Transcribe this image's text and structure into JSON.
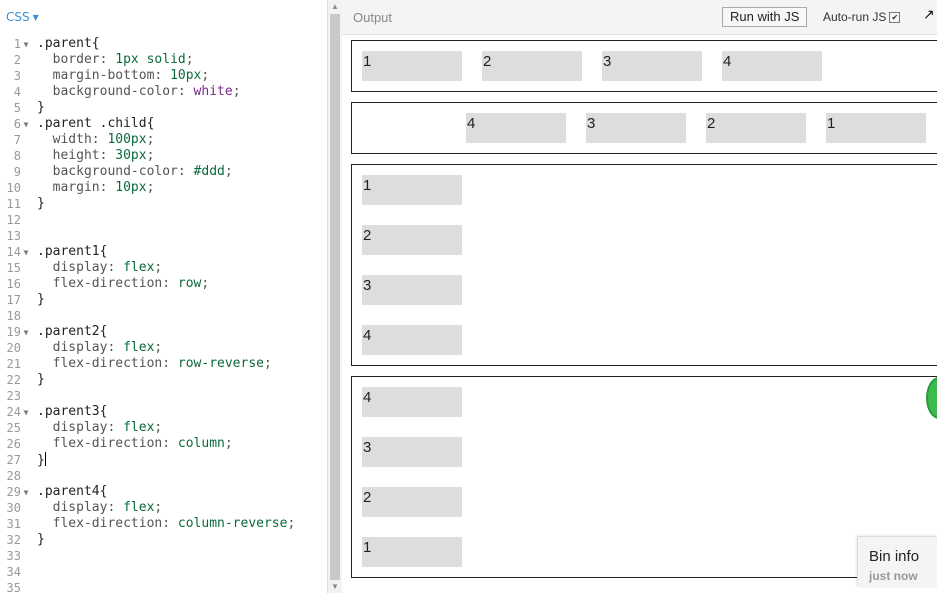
{
  "editor": {
    "language": "CSS",
    "lines": [
      {
        "n": "1",
        "fold": true,
        "parts": [
          [
            ".parent{",
            "sel"
          ]
        ]
      },
      {
        "n": "2",
        "fold": false,
        "parts": [
          [
            "  border: ",
            "kw"
          ],
          [
            "1px solid",
            "val"
          ],
          [
            ";",
            "kw"
          ]
        ]
      },
      {
        "n": "3",
        "fold": false,
        "parts": [
          [
            "  margin-bottom: ",
            "kw"
          ],
          [
            "10px",
            "val"
          ],
          [
            ";",
            "kw"
          ]
        ]
      },
      {
        "n": "4",
        "fold": false,
        "parts": [
          [
            "  background-color: ",
            "kw"
          ],
          [
            "white",
            "valpurple"
          ],
          [
            ";",
            "kw"
          ]
        ]
      },
      {
        "n": "5",
        "fold": false,
        "parts": [
          [
            "}",
            "sel"
          ]
        ]
      },
      {
        "n": "6",
        "fold": true,
        "parts": [
          [
            ".parent .child{",
            "sel"
          ]
        ]
      },
      {
        "n": "7",
        "fold": false,
        "parts": [
          [
            "  width: ",
            "kw"
          ],
          [
            "100px",
            "val"
          ],
          [
            ";",
            "kw"
          ]
        ]
      },
      {
        "n": "8",
        "fold": false,
        "parts": [
          [
            "  height: ",
            "kw"
          ],
          [
            "30px",
            "val"
          ],
          [
            ";",
            "kw"
          ]
        ]
      },
      {
        "n": "9",
        "fold": false,
        "parts": [
          [
            "  background-color: ",
            "kw"
          ],
          [
            "#ddd",
            "val"
          ],
          [
            ";",
            "kw"
          ]
        ]
      },
      {
        "n": "10",
        "fold": false,
        "parts": [
          [
            "  margin: ",
            "kw"
          ],
          [
            "10px",
            "val"
          ],
          [
            ";",
            "kw"
          ]
        ]
      },
      {
        "n": "11",
        "fold": false,
        "parts": [
          [
            "}",
            "sel"
          ]
        ]
      },
      {
        "n": "12",
        "fold": false,
        "parts": []
      },
      {
        "n": "13",
        "fold": false,
        "parts": []
      },
      {
        "n": "14",
        "fold": true,
        "parts": [
          [
            ".parent1{",
            "sel"
          ]
        ]
      },
      {
        "n": "15",
        "fold": false,
        "parts": [
          [
            "  display: ",
            "kw"
          ],
          [
            "flex",
            "val"
          ],
          [
            ";",
            "kw"
          ]
        ]
      },
      {
        "n": "16",
        "fold": false,
        "parts": [
          [
            "  flex-direction: ",
            "kw"
          ],
          [
            "row",
            "val"
          ],
          [
            ";",
            "kw"
          ]
        ]
      },
      {
        "n": "17",
        "fold": false,
        "parts": [
          [
            "}",
            "sel"
          ]
        ]
      },
      {
        "n": "18",
        "fold": false,
        "parts": []
      },
      {
        "n": "19",
        "fold": true,
        "parts": [
          [
            ".parent2{",
            "sel"
          ]
        ]
      },
      {
        "n": "20",
        "fold": false,
        "parts": [
          [
            "  display: ",
            "kw"
          ],
          [
            "flex",
            "val"
          ],
          [
            ";",
            "kw"
          ]
        ]
      },
      {
        "n": "21",
        "fold": false,
        "parts": [
          [
            "  flex-direction: ",
            "kw"
          ],
          [
            "row-reverse",
            "val"
          ],
          [
            ";",
            "kw"
          ]
        ]
      },
      {
        "n": "22",
        "fold": false,
        "parts": [
          [
            "}",
            "sel"
          ]
        ]
      },
      {
        "n": "23",
        "fold": false,
        "parts": []
      },
      {
        "n": "24",
        "fold": true,
        "parts": [
          [
            ".parent3{",
            "sel"
          ]
        ]
      },
      {
        "n": "25",
        "fold": false,
        "parts": [
          [
            "  display: ",
            "kw"
          ],
          [
            "flex",
            "val"
          ],
          [
            ";",
            "kw"
          ]
        ]
      },
      {
        "n": "26",
        "fold": false,
        "parts": [
          [
            "  flex-direction: ",
            "kw"
          ],
          [
            "column",
            "val"
          ],
          [
            ";",
            "kw"
          ]
        ]
      },
      {
        "n": "27",
        "fold": false,
        "parts": [
          [
            "}",
            "sel"
          ]
        ],
        "caret": true
      },
      {
        "n": "28",
        "fold": false,
        "parts": []
      },
      {
        "n": "29",
        "fold": true,
        "parts": [
          [
            ".parent4{",
            "sel"
          ]
        ]
      },
      {
        "n": "30",
        "fold": false,
        "parts": [
          [
            "  display: ",
            "kw"
          ],
          [
            "flex",
            "val"
          ],
          [
            ";",
            "kw"
          ]
        ]
      },
      {
        "n": "31",
        "fold": false,
        "parts": [
          [
            "  flex-direction: ",
            "kw"
          ],
          [
            "column-reverse",
            "val"
          ],
          [
            ";",
            "kw"
          ]
        ]
      },
      {
        "n": "32",
        "fold": false,
        "parts": [
          [
            "}",
            "sel"
          ]
        ]
      },
      {
        "n": "33",
        "fold": false,
        "parts": []
      },
      {
        "n": "34",
        "fold": false,
        "parts": []
      },
      {
        "n": "35",
        "fold": false,
        "parts": []
      }
    ]
  },
  "output": {
    "label": "Output",
    "run_button": "Run with JS",
    "autorun_label": "Auto-run JS",
    "autorun_checked": true,
    "boxes": [
      {
        "name": "parent1",
        "direction": "row",
        "children": [
          "1",
          "2",
          "3",
          "4"
        ]
      },
      {
        "name": "parent2",
        "direction": "row-reverse",
        "children": [
          "4",
          "3",
          "2",
          "1"
        ]
      },
      {
        "name": "parent3",
        "direction": "column",
        "children": [
          "1",
          "2",
          "3",
          "4"
        ]
      },
      {
        "name": "parent4",
        "direction": "column-reverse",
        "children": [
          "4",
          "3",
          "2",
          "1"
        ]
      }
    ]
  },
  "bin_info": {
    "title": "Bin info",
    "subtitle": "just now"
  },
  "colors": {
    "accent": "#3b8fd8",
    "child_bg": "#dddddd",
    "badge_green": "#3dbb4f"
  }
}
